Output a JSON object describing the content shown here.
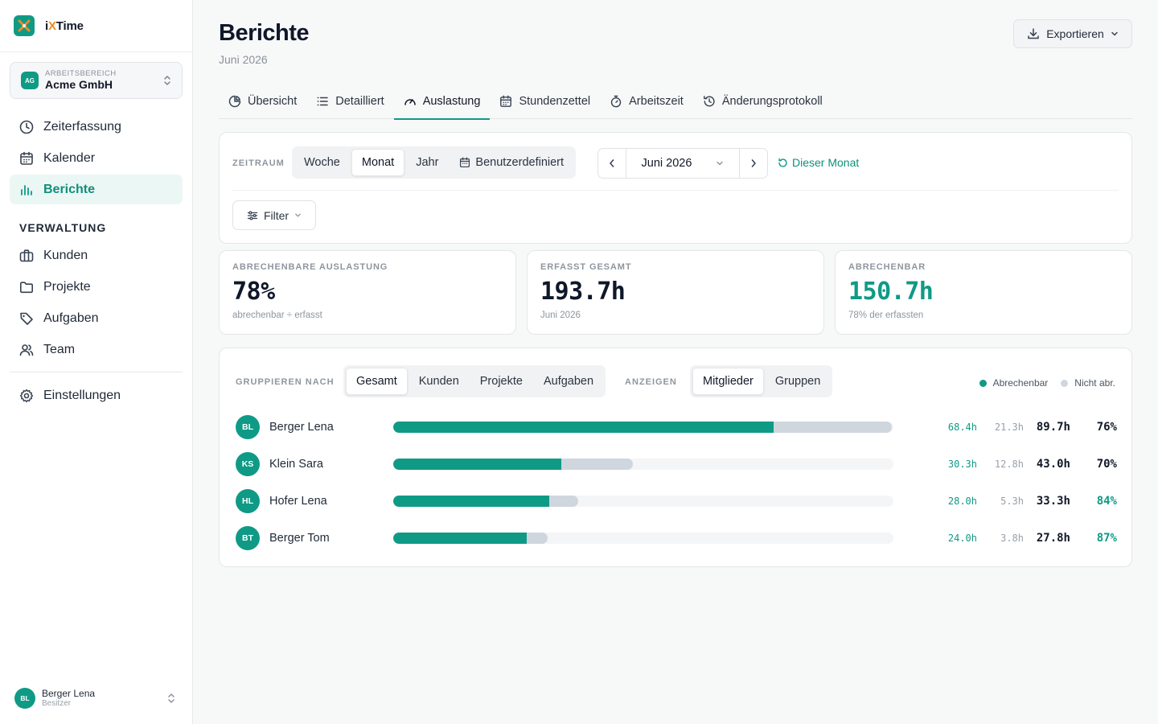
{
  "brand": {
    "name_prefix": "i",
    "name_x": "X",
    "name_suffix": "Time"
  },
  "workspace": {
    "badge": "AG",
    "label": "ARBEITSBEREICH",
    "name": "Acme GmbH"
  },
  "nav": {
    "items": [
      {
        "label": "Zeiterfassung",
        "icon": "clock-icon"
      },
      {
        "label": "Kalender",
        "icon": "calendar-icon"
      },
      {
        "label": "Berichte",
        "icon": "bar-chart-icon",
        "active": true
      }
    ],
    "section": "VERWALTUNG",
    "admin_items": [
      {
        "label": "Kunden",
        "icon": "briefcase-icon"
      },
      {
        "label": "Projekte",
        "icon": "folder-icon"
      },
      {
        "label": "Aufgaben",
        "icon": "tag-icon"
      },
      {
        "label": "Team",
        "icon": "users-icon"
      }
    ],
    "settings": {
      "label": "Einstellungen",
      "icon": "gear-icon"
    }
  },
  "user": {
    "initials": "BL",
    "name": "Berger Lena",
    "role": "Besitzer"
  },
  "page": {
    "title": "Berichte",
    "subtitle": "Juni 2026",
    "export_label": "Exportieren"
  },
  "tabs": [
    {
      "label": "Übersicht",
      "icon": "pie-chart-icon"
    },
    {
      "label": "Detailliert",
      "icon": "list-icon"
    },
    {
      "label": "Auslastung",
      "icon": "gauge-icon",
      "active": true
    },
    {
      "label": "Stundenzettel",
      "icon": "calendar-icon"
    },
    {
      "label": "Arbeitszeit",
      "icon": "stopwatch-icon"
    },
    {
      "label": "Änderungsprotokoll",
      "icon": "history-icon"
    }
  ],
  "filters": {
    "period_label": "ZEITRAUM",
    "periods": [
      "Woche",
      "Monat",
      "Jahr",
      "Benutzerdefiniert"
    ],
    "active_period": "Monat",
    "month": "Juni 2026",
    "this_month": "Dieser Monat",
    "filter_label": "Filter"
  },
  "kpis": [
    {
      "label": "ABRECHENBARE AUSLASTUNG",
      "value": "78%",
      "sub": "abrechenbar ÷ erfasst"
    },
    {
      "label": "ERFASST GESAMT",
      "value": "193.7h",
      "sub": "Juni 2026"
    },
    {
      "label": "ABRECHENBAR",
      "value": "150.7h",
      "sub": "78% der erfassten"
    }
  ],
  "grouping": {
    "group_label": "GRUPPIEREN NACH",
    "groups": [
      "Gesamt",
      "Kunden",
      "Projekte",
      "Aufgaben"
    ],
    "active_group": "Gesamt",
    "show_label": "ANZEIGEN",
    "shows": [
      "Mitglieder",
      "Gruppen"
    ],
    "active_show": "Mitglieder",
    "legend_billable": "Abrechenbar",
    "legend_nonbillable": "Nicht abr."
  },
  "colors": {
    "accent": "#0f9a86",
    "nonbillable": "#cfd6de",
    "orange": "#f08a24"
  },
  "members": [
    {
      "initials": "BL",
      "name": "Berger Lena",
      "billable": "68.4h",
      "nonbillable": "21.3h",
      "total": "89.7h",
      "pct": "76%",
      "b_hours": 68.4,
      "nb_hours": 21.3,
      "good": false
    },
    {
      "initials": "KS",
      "name": "Klein Sara",
      "billable": "30.3h",
      "nonbillable": "12.8h",
      "total": "43.0h",
      "pct": "70%",
      "b_hours": 30.3,
      "nb_hours": 12.8,
      "good": false
    },
    {
      "initials": "HL",
      "name": "Hofer Lena",
      "billable": "28.0h",
      "nonbillable": "5.3h",
      "total": "33.3h",
      "pct": "84%",
      "b_hours": 28.0,
      "nb_hours": 5.3,
      "good": true
    },
    {
      "initials": "BT",
      "name": "Berger Tom",
      "billable": "24.0h",
      "nonbillable": "3.8h",
      "total": "27.8h",
      "pct": "87%",
      "b_hours": 24.0,
      "nb_hours": 3.8,
      "good": true
    }
  ]
}
